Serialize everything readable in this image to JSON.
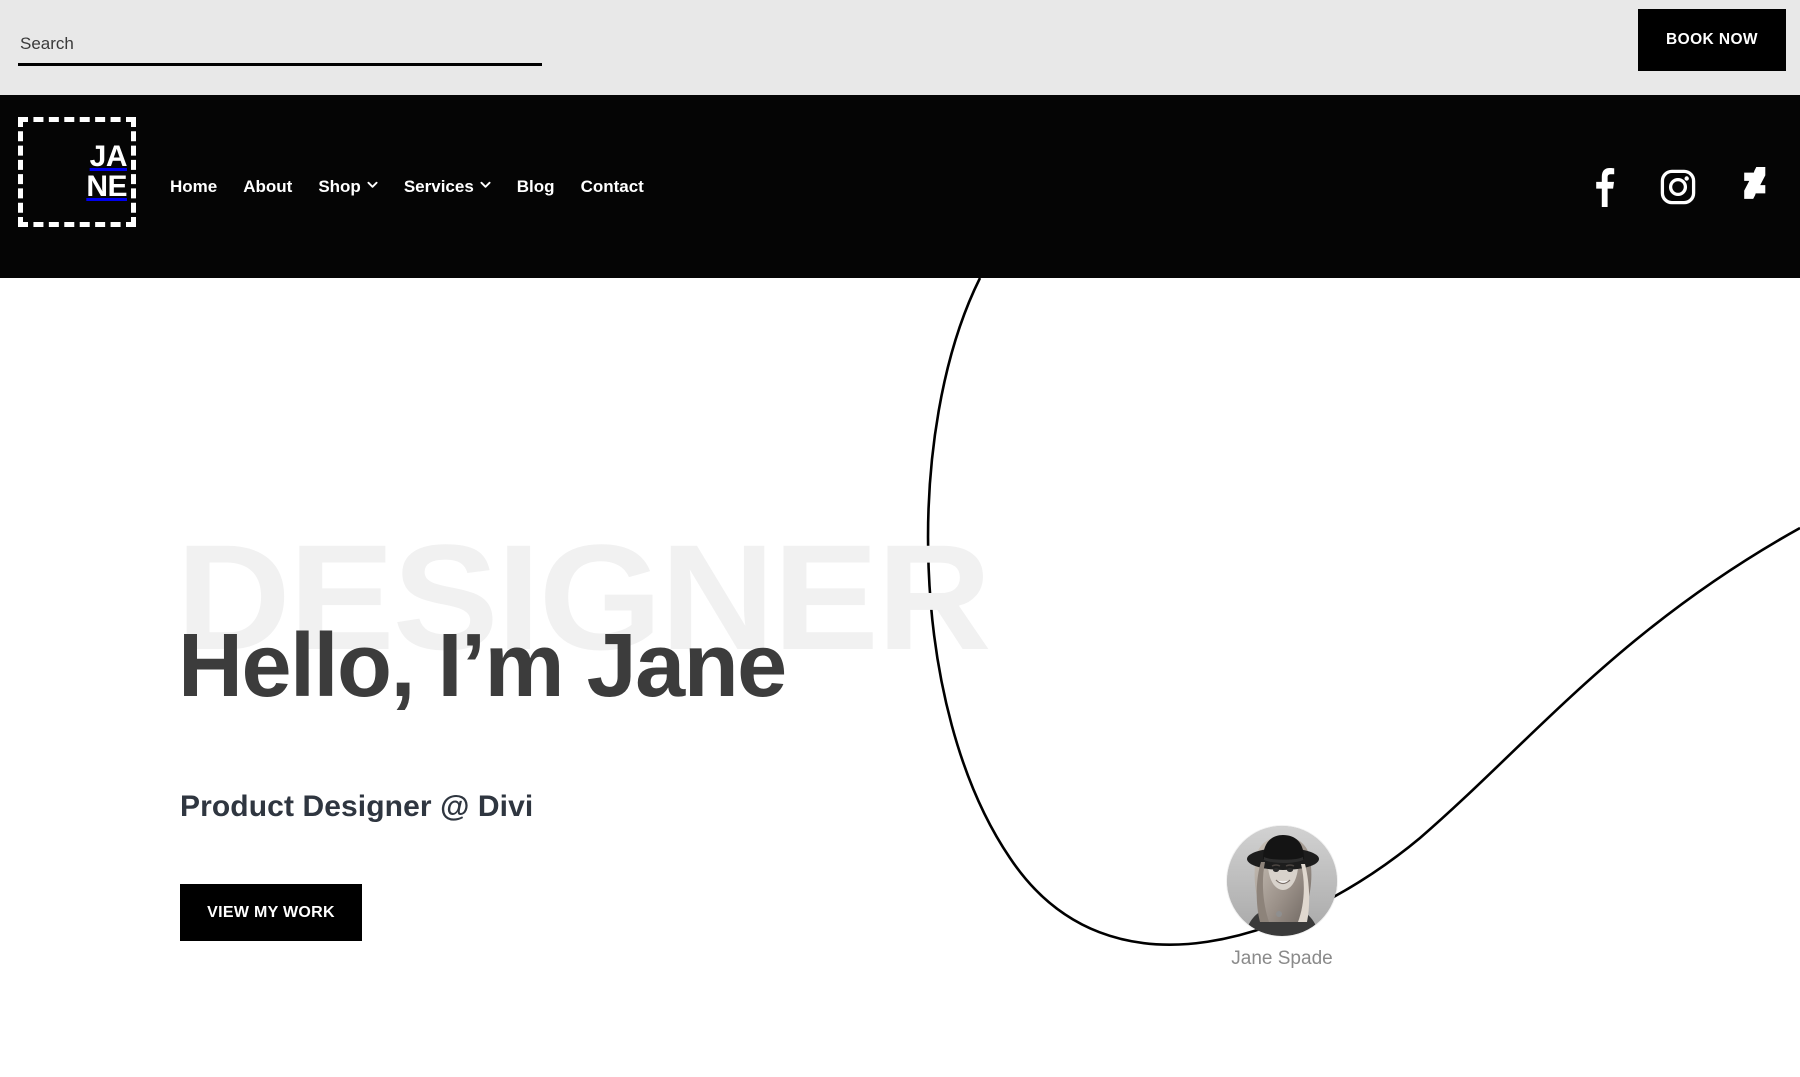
{
  "topbar": {
    "search": {
      "placeholder": "Search",
      "value": ""
    },
    "book_now_label": "BOOK NOW"
  },
  "nav": {
    "logo": {
      "line1": "JA",
      "line2": "NE",
      "alt": "JANE"
    },
    "items": [
      {
        "label": "Home",
        "has_dropdown": false
      },
      {
        "label": "About",
        "has_dropdown": false
      },
      {
        "label": "Shop",
        "has_dropdown": true
      },
      {
        "label": "Services",
        "has_dropdown": true
      },
      {
        "label": "Blog",
        "has_dropdown": false
      },
      {
        "label": "Contact",
        "has_dropdown": false
      }
    ],
    "socials": [
      {
        "name": "facebook-icon"
      },
      {
        "name": "instagram-icon"
      },
      {
        "name": "deviantart-icon"
      }
    ]
  },
  "hero": {
    "watermark": "DESIGNER",
    "title": "Hello, I’m Jane",
    "subtitle": "Product Designer @ Divi",
    "cta_label": "VIEW MY WORK",
    "avatar_caption": "Jane Spade"
  },
  "colors": {
    "topbar_bg": "#e8e8e8",
    "nav_bg": "#050505",
    "page_bg": "#ffffff",
    "accent_black": "#000000",
    "title_gray": "#3c3c3c",
    "watermark_gray": "#f1f1f1",
    "caption_gray": "#8a8a8a"
  }
}
